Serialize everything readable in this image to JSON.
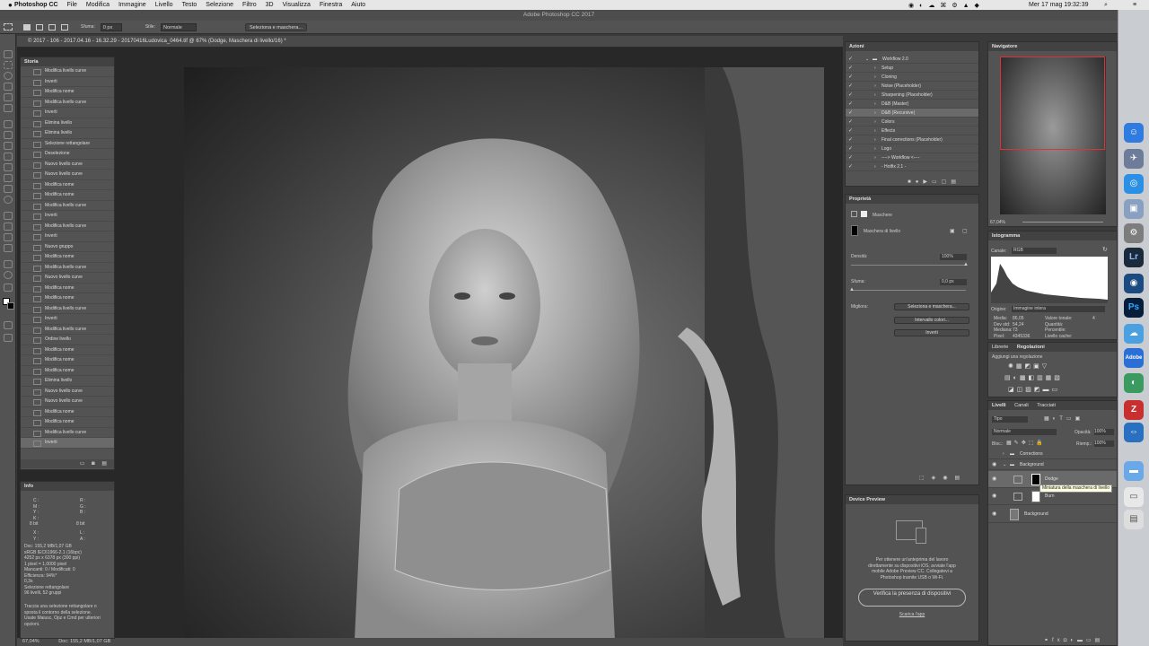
{
  "menubar": {
    "apple": "",
    "app": "Photoshop CC",
    "items": [
      "File",
      "Modifica",
      "Immagine",
      "Livello",
      "Testo",
      "Selezione",
      "Filtro",
      "3D",
      "Visualizza",
      "Finestra",
      "Aiuto"
    ],
    "datetime": "Mer 17 mag  19:32:39"
  },
  "app_title": "Adobe Photoshop CC 2017",
  "options": {
    "sfuma_label": "Sfuma:",
    "sfuma_value": "0 px",
    "stile_label": "Stile:",
    "stile_value": "Normale",
    "select_mask": "Seleziona e maschera..."
  },
  "document": {
    "tab_title": "© 2017 - 106 - 2017.04.16 - 16.32.29 - 20170416Ludovica_0464.tif @ 67% (Dodge, Maschera di livello/16) *",
    "zoom": "67,04%",
    "status": "Doc: 155,2 MB/1,07 GB"
  },
  "history": {
    "title": "Storia",
    "items": [
      "Modifica livello curve",
      "Inverti",
      "Modifica nome",
      "Modifica livello curve",
      "Inverti",
      "Elimina livello",
      "Elimina livello",
      "Selezione rettangolare",
      "Deselezione",
      "Nuovo livello curve",
      "Nuovo livello curve",
      "Modifica nome",
      "Modifica nome",
      "Modifica livello curve",
      "Inverti",
      "Modifica livello curve",
      "Inverti",
      "Nuovo gruppo",
      "Modifica nome",
      "Modifica livello curve",
      "Nuovo livello curve",
      "Modifica nome",
      "Modifica nome",
      "Modifica livello curve",
      "Inverti",
      "Modifica livello curve",
      "Ordine livello",
      "Modifica nome",
      "Modifica nome",
      "Modifica nome",
      "Elimina livello",
      "Nuovo livello curve",
      "Nuovo livello curve",
      "Modifica nome",
      "Modifica nome",
      "Modifica livello curve",
      "Inverti"
    ]
  },
  "info": {
    "title": "Info",
    "c": "C :",
    "m": "M :",
    "y": "Y :",
    "k": "K :",
    "r": "R :",
    "g": "G :",
    "b": "B :",
    "bit1": "8 bit",
    "bit2": "8 bit",
    "x": "X :",
    "yy": "Y :",
    "w": "L :",
    "h": "A :",
    "lines": [
      "Doc: 155,2 MB/1,07 GB",
      "sRGB IEC61966-2.1 (16bpc)",
      "4252 px x 6378 px (300 ppi)",
      "1 pixel = 1,0000 pixel",
      "Mancanti: 0 / Modificati: 0",
      "Efficienza: 94%*",
      "0,3s",
      "Selezione rettangolare",
      "96 livelli, 52 gruppi"
    ],
    "help": [
      "Traccia una selezione rettangolare o",
      "sposta il contorno della selezione.",
      "Usate Maiusc, Opz e Cmd per ulteriori",
      "opzioni."
    ]
  },
  "actions": {
    "title": "Azioni",
    "items": [
      {
        "label": "Workflow 2.0",
        "level": 0
      },
      {
        "label": "Setup",
        "level": 1
      },
      {
        "label": "Cloning",
        "level": 1
      },
      {
        "label": "Noise (Placeholder)",
        "level": 1
      },
      {
        "label": "Sharpening (Placeholder)",
        "level": 1
      },
      {
        "label": "D&B (Master)",
        "level": 1
      },
      {
        "label": "D&B (Recursive)",
        "level": 1
      },
      {
        "label": "Colors",
        "level": 1
      },
      {
        "label": "Effects",
        "level": 1
      },
      {
        "label": "Final corrections (Placeholder)",
        "level": 1
      },
      {
        "label": "Logo",
        "level": 1
      },
      {
        "label": "----> Workflow <----",
        "level": 1
      },
      {
        "label": "- Hotfix 2.1 -",
        "level": 1
      }
    ]
  },
  "properties": {
    "title": "Proprietà",
    "section": "Maschere",
    "mask_name": "Maschera di livello",
    "density_label": "Densità:",
    "density_value": "100%",
    "feather_label": "Sfuma:",
    "feather_value": "0,0 px",
    "refine_label": "Migliora:",
    "btn_select_mask": "Seleziona e maschera...",
    "btn_color_range": "Intervallo colori...",
    "btn_invert": "Inverti"
  },
  "device_preview": {
    "title": "Device Preview",
    "text": [
      "Per ottenere un'anteprima del lavoro",
      "direttamente su dispositivi iOS, avviate l'app",
      "mobile Adobe Preview CC. Collegatevi a",
      "Photoshop tramite USB o Wi-Fi."
    ],
    "button": "Verifica la presenza di dispositivi",
    "link": "Scarica l'app"
  },
  "navigator": {
    "title": "Navigatore",
    "zoom": "67,04%"
  },
  "histogram": {
    "title": "Istogramma",
    "canale_label": "Canale:",
    "canale_value": "RGB",
    "origine_label": "Origine:",
    "origine_value": "Immagine intera",
    "stats_left": [
      "Media:",
      "Dev std:",
      "Mediana:",
      "Pixel:"
    ],
    "stats_left_v": [
      "86,05",
      "54,24",
      "73",
      "4345336"
    ],
    "stats_right": [
      "Valore tonale:",
      "Quantità:",
      "Percentile:",
      "Livello cache:"
    ],
    "stats_right_v": [
      "",
      "",
      "",
      "4"
    ]
  },
  "adjustments": {
    "tab1": "Librerie",
    "tab2": "Regolazioni",
    "add": "Aggiungi una regolazione"
  },
  "layers": {
    "tab1": "Livelli",
    "tab2": "Canali",
    "tab3": "Tracciati",
    "kind": "Tipo",
    "blend": "Normale",
    "opacity_label": "Opacità:",
    "opacity_value": "100%",
    "lock_label": "Bloc.:",
    "fill_label": "Riemp.:",
    "fill_value": "100%",
    "rows": [
      "Corrections",
      "Background",
      "Dodge",
      "Burn",
      "Background"
    ],
    "tooltip": "Miniatura della maschera di livello"
  }
}
